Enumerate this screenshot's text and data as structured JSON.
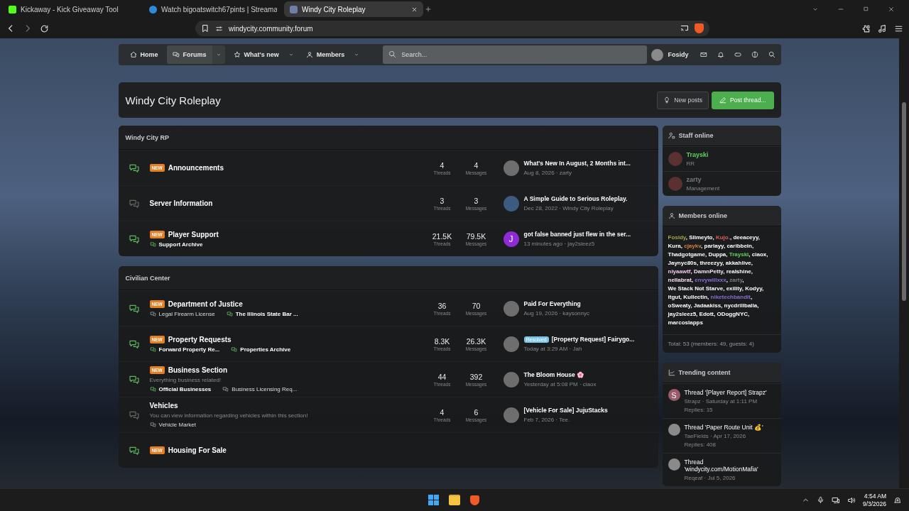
{
  "browser": {
    "tabs": [
      {
        "title": "Kickaway - Kick Giveaway Tool",
        "selected": false
      },
      {
        "title": "Watch bigoatswitch67pints | Streama",
        "selected": false
      },
      {
        "title": "Windy City Roleplay",
        "selected": true
      }
    ],
    "url": "windycity.community.forum"
  },
  "nav": {
    "items": [
      {
        "label": "Home",
        "selected": false,
        "dropdown": false
      },
      {
        "label": "Forums",
        "selected": true,
        "dropdown": true
      },
      {
        "label": "What's new",
        "selected": false,
        "dropdown": true
      },
      {
        "label": "Members",
        "selected": false,
        "dropdown": true
      }
    ],
    "search": {
      "placeholder": "Search..."
    },
    "user": "Fosidy"
  },
  "page": {
    "title": "Windy City Roleplay",
    "buttons": [
      {
        "label": "New posts",
        "kind": "secondary"
      },
      {
        "label": "Post thread...",
        "kind": "primary"
      }
    ]
  },
  "categories": [
    {
      "title": "Windy City RP",
      "forums": [
        {
          "title": "Announcements",
          "badge": "NEW",
          "unread": true,
          "stats": [
            {
              "value": "4",
              "label": "Threads"
            },
            {
              "value": "4",
              "label": "Messages"
            }
          ],
          "last_post": {
            "title": "What's New In August, 2 Months int...",
            "meta": "Aug 8, 2026 · zarty",
            "avatar": {
              "kind": "photo"
            }
          }
        },
        {
          "title": "Server Information",
          "unread": false,
          "stats": [
            {
              "value": "3",
              "label": "Threads"
            },
            {
              "value": "3",
              "label": "Messages"
            }
          ],
          "last_post": {
            "title": "A Simple Guide to Serious Roleplay.",
            "meta": "Dec 28, 2022 · Windy City Roleplay",
            "avatar": {
              "kind": "logo"
            }
          }
        },
        {
          "title": "Player Support",
          "badge": "NEW",
          "unread": true,
          "subforums": [
            {
              "title": "Support Archive",
              "unread": true
            }
          ],
          "stats": [
            {
              "value": "21.5K",
              "label": "Threads"
            },
            {
              "value": "79.5K",
              "label": "Messages"
            }
          ],
          "last_post": {
            "title": "got false banned just flew in the ser...",
            "meta": "13 minutes ago · jay2sleez5",
            "avatar": {
              "kind": "letter",
              "letter": "J",
              "color": "#8e2bd6"
            }
          }
        }
      ]
    },
    {
      "title": "Civilian Center",
      "forums": [
        {
          "title": "Department of Justice",
          "badge": "NEW",
          "unread": true,
          "subforums": [
            {
              "title": "Legal Firearm License",
              "unread": false
            },
            {
              "title": "The Illinois State Bar ...",
              "unread": true
            }
          ],
          "stats": [
            {
              "value": "36",
              "label": "Threads"
            },
            {
              "value": "70",
              "label": "Messages"
            }
          ],
          "last_post": {
            "title": "Paid For Everything",
            "meta": "Aug 19, 2026 · kaysonnyc",
            "avatar": {
              "kind": "photo"
            }
          }
        },
        {
          "title": "Property Requests",
          "badge": "NEW",
          "unread": true,
          "subforums": [
            {
              "title": "Forward Property Re...",
              "unread": true
            },
            {
              "title": "Properties Archive",
              "unread": true
            }
          ],
          "stats": [
            {
              "value": "8.3K",
              "label": "Threads"
            },
            {
              "value": "26.3K",
              "label": "Messages"
            }
          ],
          "last_post": {
            "prefix": "Resolved",
            "title": "[Property Request] Fairygo...",
            "meta": "Today at 3:29 AM · Jah",
            "avatar": {
              "kind": "photo"
            }
          }
        },
        {
          "title": "Business Section",
          "badge": "NEW",
          "unread": true,
          "description": "Everything business related!",
          "subforums": [
            {
              "title": "Official Businesses",
              "unread": true
            },
            {
              "title": "Business Licensing Req...",
              "unread": false
            }
          ],
          "stats": [
            {
              "value": "44",
              "label": "Threads"
            },
            {
              "value": "392",
              "label": "Messages"
            }
          ],
          "last_post": {
            "title": "The Bloom House 🌸",
            "meta": "Yesterday at 5:08 PM · ciaox",
            "avatar": {
              "kind": "photo"
            }
          }
        },
        {
          "title": "Vehicles",
          "unread": false,
          "description": "You can view information regarding vehicles within this section!",
          "subforums": [
            {
              "title": "Vehicle Market",
              "unread": false
            }
          ],
          "stats": [
            {
              "value": "4",
              "label": "Threads"
            },
            {
              "value": "6",
              "label": "Messages"
            }
          ],
          "last_post": {
            "title": "[Vehicle For Sale] JujuStacks",
            "meta": "Feb 7, 2026 · Tee.",
            "avatar": {
              "kind": "photo"
            }
          }
        },
        {
          "title": "Housing For Sale",
          "badge": "NEW",
          "unread": true
        }
      ]
    }
  ],
  "sidebar": {
    "staff": {
      "title": "Staff online",
      "members": [
        {
          "name": "Trayski",
          "role": "RR",
          "color": "#5fd35f"
        },
        {
          "name": "zarty",
          "role": "Management",
          "color": "#7a7a7a"
        }
      ]
    },
    "members": {
      "title": "Members online",
      "separator": ", ",
      "names": [
        {
          "name": "Fosidy",
          "color": "#a3a34a"
        },
        {
          "name": "Slimeyto",
          "color": "#ffffff"
        },
        {
          "name": "Kujo.",
          "color": "#e35b5b"
        },
        {
          "name": "deeaceyy",
          "color": "#ffffff"
        },
        {
          "name": "Kura",
          "color": "#ffffff"
        },
        {
          "name": "cjaykv",
          "color": "#d2803a"
        },
        {
          "name": "parlayy",
          "color": "#ffffff"
        },
        {
          "name": "caribbein",
          "color": "#ffffff"
        },
        {
          "name": "Thadgotgame",
          "color": "#ffffff"
        },
        {
          "name": "Duppa",
          "color": "#ffffff"
        },
        {
          "name": "Trayski",
          "color": "#5fd35f"
        },
        {
          "name": "ciaox",
          "color": "#ffffff"
        },
        {
          "name": "Jaynyc80s",
          "color": "#ffffff"
        },
        {
          "name": "threezyy",
          "color": "#ffffff"
        },
        {
          "name": "akkahlive",
          "color": "#ffffff"
        },
        {
          "name": "niyaawtf",
          "color": "#f3c6f3"
        },
        {
          "name": "DamnPetty",
          "color": "#f6e6f6"
        },
        {
          "name": "realshine",
          "color": "#ffffff"
        },
        {
          "name": "nellabrat",
          "color": "#f6e0f0"
        },
        {
          "name": "envywillxxx",
          "color": "#8a6ad8"
        },
        {
          "name": "zarty",
          "color": "#7a7a7a"
        },
        {
          "name": "We Stack Not Starve",
          "color": "#ffffff"
        },
        {
          "name": "exility",
          "color": "#ffffff"
        },
        {
          "name": "Kodyy",
          "color": "#ffffff"
        },
        {
          "name": "itgut",
          "color": "#ffffff"
        },
        {
          "name": "Kullectin",
          "color": "#ffffff"
        },
        {
          "name": "niketechbandit",
          "color": "#8a6ad8"
        },
        {
          "name": "oSweaty",
          "color": "#ffffff"
        },
        {
          "name": "Jadaakiss",
          "color": "#ffffff"
        },
        {
          "name": "nycdrillballa",
          "color": "#ffffff"
        },
        {
          "name": "jay2sleez5",
          "color": "#ffffff"
        },
        {
          "name": "Edott",
          "color": "#ffffff"
        },
        {
          "name": "ODoggNYC",
          "color": "#ffffff"
        },
        {
          "name": "marcoslapps",
          "color": "#ffffff"
        }
      ],
      "total": "Total: 53 (members: 49, guests: 4)"
    },
    "trending": {
      "title": "Trending content",
      "items": [
        {
          "title": "Thread '[Player Report] Strapz'",
          "meta": "Strapz · Saturday at 1:11 PM",
          "replies": "Replies: 15",
          "avatar": {
            "kind": "letter",
            "letter": "S",
            "color": "#9a5a6a"
          }
        },
        {
          "title": "Thread 'Paper Route Unit 💰'",
          "meta": "TaeFields · Apr 17, 2026",
          "replies": "Replies: 408",
          "avatar": {
            "kind": "photo"
          }
        },
        {
          "title": "Thread 'windycity.com/MotionMafia'",
          "meta": "Reqeaf · Jul 5, 2026",
          "avatar": {
            "kind": "photo"
          }
        }
      ]
    }
  },
  "taskbar": {
    "time": "4:54 AM",
    "date": "9/3/2026"
  }
}
